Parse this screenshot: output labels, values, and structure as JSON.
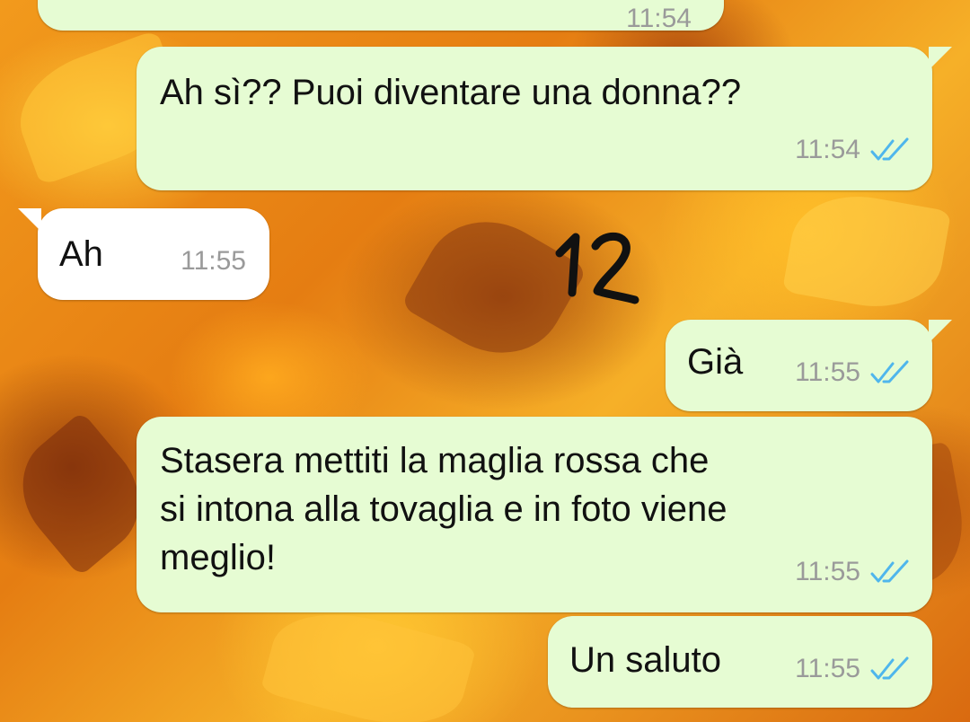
{
  "background": {
    "theme": "autumn-leaves",
    "colors": [
      "#f29a1c",
      "#e57d12",
      "#f6b028",
      "#d96a10"
    ]
  },
  "colors": {
    "outgoing_bubble": "#e6fcd3",
    "incoming_bubble": "#ffffff",
    "read_ticks": "#4fb6ec",
    "meta_text": "#9a9a9a"
  },
  "annotation": {
    "text": "12"
  },
  "messages": [
    {
      "direction": "out",
      "text": "",
      "time": "11:54",
      "status": "read-icon"
    },
    {
      "direction": "out",
      "text": "Ah sì?? Puoi diventare una donna??",
      "time": "11:54",
      "status": "read-icon"
    },
    {
      "direction": "in",
      "text": "Ah",
      "time": "11:55"
    },
    {
      "direction": "out",
      "text": "Già",
      "time": "11:55",
      "status": "read-icon"
    },
    {
      "direction": "out",
      "text": "Stasera mettiti la maglia rossa che\nsi intona alla tovaglia e in foto viene\nmeglio!",
      "time": "11:55",
      "status": "read-icon"
    },
    {
      "direction": "out",
      "text": "Un saluto",
      "time": "11:55",
      "status": "read-icon"
    }
  ]
}
